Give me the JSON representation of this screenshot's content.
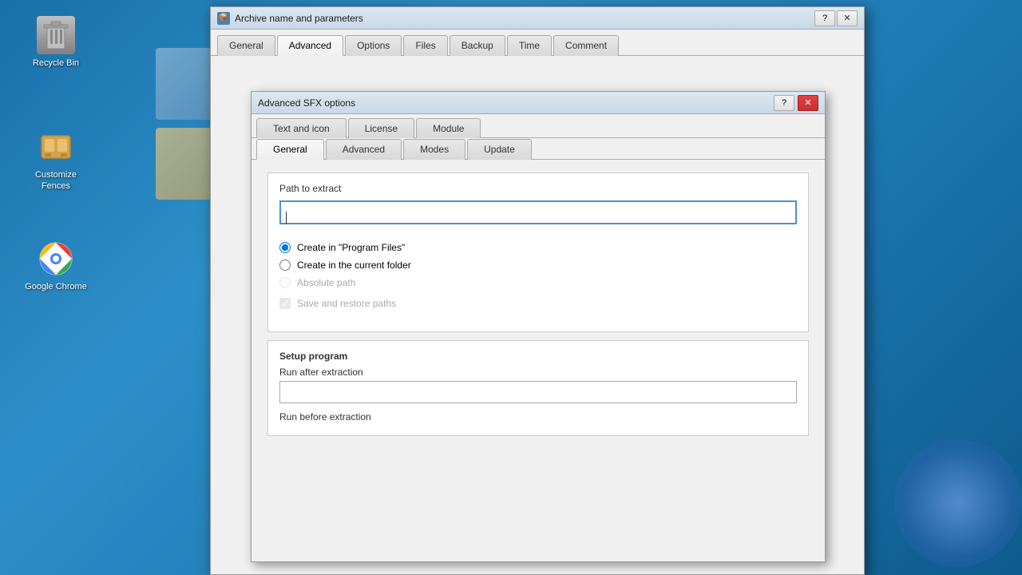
{
  "desktop": {
    "icons": [
      {
        "id": "recycle-bin",
        "label": "Recycle Bin",
        "symbol": "🗑"
      },
      {
        "id": "customize-fences",
        "label": "Customize Fences",
        "symbol": "📁"
      },
      {
        "id": "google-chrome",
        "label": "Google Chrome",
        "symbol": "⊙"
      }
    ]
  },
  "outer_dialog": {
    "title": "Archive name and parameters",
    "title_icon": "📦",
    "tabs": [
      {
        "id": "general",
        "label": "General",
        "active": false
      },
      {
        "id": "advanced",
        "label": "Advanced",
        "active": true
      },
      {
        "id": "options",
        "label": "Options",
        "active": false
      },
      {
        "id": "files",
        "label": "Files",
        "active": false
      },
      {
        "id": "backup",
        "label": "Backup",
        "active": false
      },
      {
        "id": "time",
        "label": "Time",
        "active": false
      },
      {
        "id": "comment",
        "label": "Comment",
        "active": false
      }
    ],
    "help_btn": "?",
    "close_btn": "✕"
  },
  "inner_dialog": {
    "title": "Advanced SFX options",
    "help_btn": "?",
    "close_btn": "✕",
    "tabs_row1": [
      {
        "id": "text-icon",
        "label": "Text and icon",
        "active": false
      },
      {
        "id": "license",
        "label": "License",
        "active": false
      },
      {
        "id": "module",
        "label": "Module",
        "active": false
      }
    ],
    "tabs_row2": [
      {
        "id": "general",
        "label": "General",
        "active": true
      },
      {
        "id": "advanced",
        "label": "Advanced",
        "active": false
      },
      {
        "id": "modes",
        "label": "Modes",
        "active": false
      },
      {
        "id": "update",
        "label": "Update",
        "active": false
      }
    ],
    "content": {
      "path_label": "Path to extract",
      "path_value": "",
      "radio_options": [
        {
          "id": "program-files",
          "label": "Create in \"Program Files\"",
          "checked": true,
          "disabled": false
        },
        {
          "id": "current-folder",
          "label": "Create in the current folder",
          "checked": false,
          "disabled": false
        },
        {
          "id": "absolute-path",
          "label": "Absolute path",
          "checked": false,
          "disabled": true
        }
      ],
      "checkbox_label": "Save and restore paths",
      "checkbox_checked": true,
      "setup_section": "Setup program",
      "run_after_label": "Run after extraction",
      "run_after_value": "",
      "run_before_label": "Run before extraction"
    }
  }
}
